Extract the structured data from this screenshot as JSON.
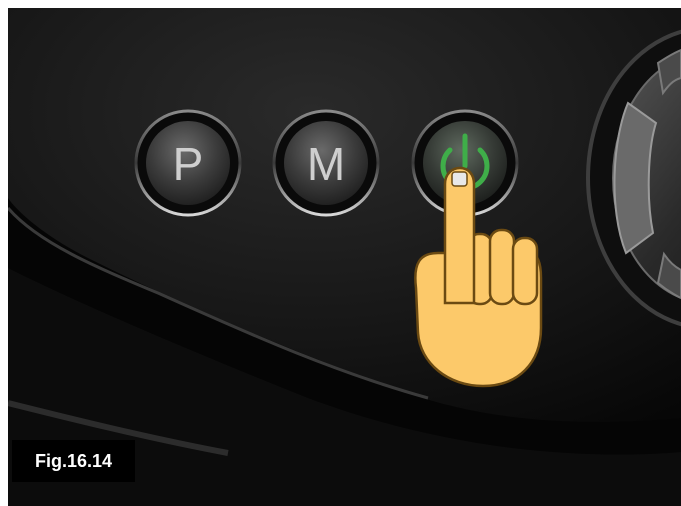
{
  "figure": {
    "label": "Fig.16.14"
  },
  "buttons": [
    {
      "label": "P",
      "icon": null
    },
    {
      "label": "M",
      "icon": null
    },
    {
      "label": "",
      "icon": "power-icon",
      "lit": true,
      "light_color": "#3fae49"
    }
  ],
  "colors": {
    "device_body": "#141414",
    "hand_fill": "#fcc96a",
    "power_glow": "#3fae49"
  }
}
